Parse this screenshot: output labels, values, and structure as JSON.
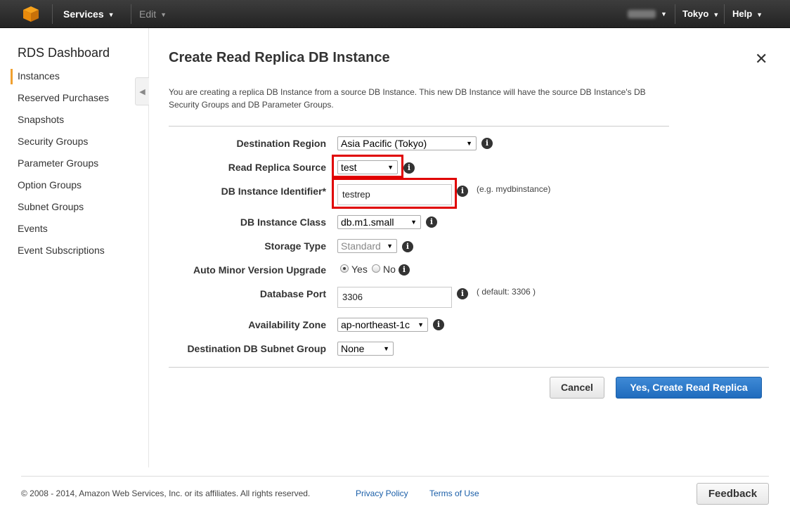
{
  "topbar": {
    "services_label": "Services",
    "edit_label": "Edit",
    "region_label": "Tokyo",
    "help_label": "Help"
  },
  "sidebar": {
    "title": "RDS Dashboard",
    "items": [
      {
        "label": "Instances"
      },
      {
        "label": "Reserved Purchases"
      },
      {
        "label": "Snapshots"
      },
      {
        "label": "Security Groups"
      },
      {
        "label": "Parameter Groups"
      },
      {
        "label": "Option Groups"
      },
      {
        "label": "Subnet Groups"
      },
      {
        "label": "Events"
      },
      {
        "label": "Event Subscriptions"
      }
    ],
    "active_index": 0
  },
  "dialog": {
    "title": "Create Read Replica DB Instance",
    "description": "You are creating a replica DB Instance from a source DB Instance. This new DB Instance will have the source DB Instance's DB Security Groups and DB Parameter Groups.",
    "fields": {
      "destination_region": {
        "label": "Destination Region",
        "value": "Asia Pacific (Tokyo)"
      },
      "read_replica_source": {
        "label": "Read Replica Source",
        "value": "test"
      },
      "db_instance_identifier": {
        "label": "DB Instance Identifier*",
        "value": "testrep",
        "hint": "(e.g. mydbinstance)"
      },
      "db_instance_class": {
        "label": "DB Instance Class",
        "value": "db.m1.small"
      },
      "storage_type": {
        "label": "Storage Type",
        "value": "Standard"
      },
      "auto_minor_version_upgrade": {
        "label": "Auto Minor Version Upgrade",
        "yes_label": "Yes",
        "no_label": "No",
        "selected": "Yes"
      },
      "database_port": {
        "label": "Database Port",
        "value": "3306",
        "hint": "( default: 3306 )"
      },
      "availability_zone": {
        "label": "Availability Zone",
        "value": "ap-northeast-1c"
      },
      "destination_db_subnet_group": {
        "label": "Destination DB Subnet Group",
        "value": "None"
      }
    },
    "cancel_label": "Cancel",
    "create_label": "Yes, Create Read Replica",
    "info_glyph": "i",
    "close_glyph": "✕"
  },
  "footer": {
    "copyright": "© 2008 - 2014, Amazon Web Services, Inc. or its affiliates. All rights reserved.",
    "privacy_label": "Privacy Policy",
    "terms_label": "Terms of Use",
    "feedback_label": "Feedback"
  },
  "colors": {
    "highlight": "#e00000",
    "primary_button": "#1f6bbd",
    "active_marker": "#f0a030"
  }
}
